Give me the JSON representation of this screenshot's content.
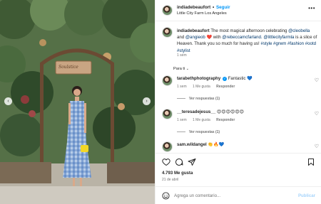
{
  "post": {
    "username": "indiadebeaufort",
    "follow_label": "Seguir",
    "separator": "•",
    "location": "Little City Farm Los Angeles",
    "more_icon": "more-horizontal-icon"
  },
  "photo": {
    "sign_text": "Soulstice",
    "prev_icon": "chevron-left-icon",
    "next_icon": "chevron-right-icon"
  },
  "caption": {
    "username": "indiadebeaufort",
    "text_1": "The most magical afternoon celebrating",
    "mention_1": "@cleobella",
    "and": "and",
    "mention_2": "@angieob",
    "heart": "❤️",
    "with": "with",
    "mention_3": "@rebeccamcfarland.",
    "mention_4": "@littlecityfarmla",
    "text_2": "is a slice of Heaven. Thank you so much for having us!",
    "hashtags": "#style #grwm #fashion #ootd #stylist",
    "time": "1 sem"
  },
  "para_ti": {
    "label": "Para ti",
    "chevron": "⌄"
  },
  "comments": [
    {
      "username": "tarabethphotography",
      "verified": true,
      "text": "Fantastic 💙",
      "time": "1 sem",
      "likes": "1 Me gusta",
      "reply": "Responder",
      "view_replies": "Ver respuestas (1)"
    },
    {
      "username": "__teresadejesus__",
      "verified": false,
      "text": "😍😍😍😍😍😍",
      "time": "1 sem",
      "likes": "1 Me gusta",
      "reply": "Responder",
      "view_replies": "Ver respuestas (1)"
    },
    {
      "username": "sam.wildangel",
      "verified": false,
      "text": "👏🔥💙",
      "time": "",
      "likes": "",
      "reply": "",
      "view_replies": ""
    }
  ],
  "actions": {
    "like_icon": "heart-icon",
    "comment_icon": "comment-icon",
    "share_icon": "share-icon",
    "save_icon": "bookmark-icon"
  },
  "likes_count": "4.793 Me gusta",
  "date": "21 de abril",
  "add_comment": {
    "placeholder": "Agrega un comentario...",
    "publish_label": "Publicar",
    "emoji_icon": "emoji-icon"
  },
  "colors": {
    "accent": "#0095f6",
    "link": "#00376b",
    "publish_disabled": "#a6d4fb",
    "text": "#262626",
    "muted": "#737373",
    "border": "#efefef"
  }
}
